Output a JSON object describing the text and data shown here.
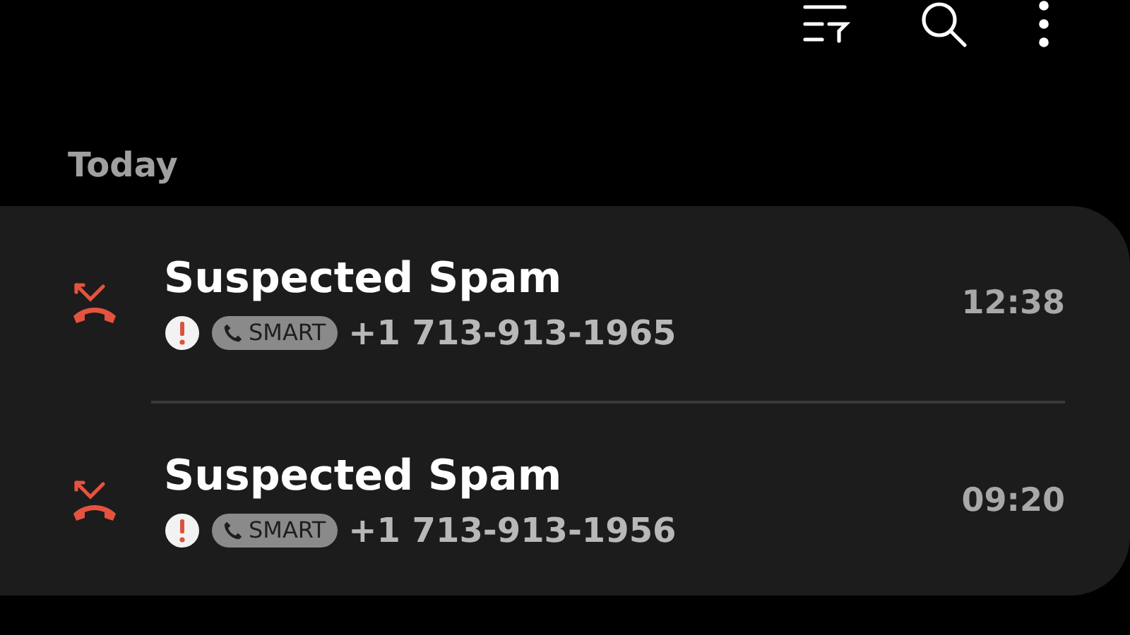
{
  "section_title": "Today",
  "calls": [
    {
      "title": "Suspected Spam",
      "badge": "SMART",
      "number": "+1 713-913-1965",
      "time": "12:38"
    },
    {
      "title": "Suspected Spam",
      "badge": "SMART",
      "number": "+1 713-913-1956",
      "time": "09:20"
    }
  ]
}
